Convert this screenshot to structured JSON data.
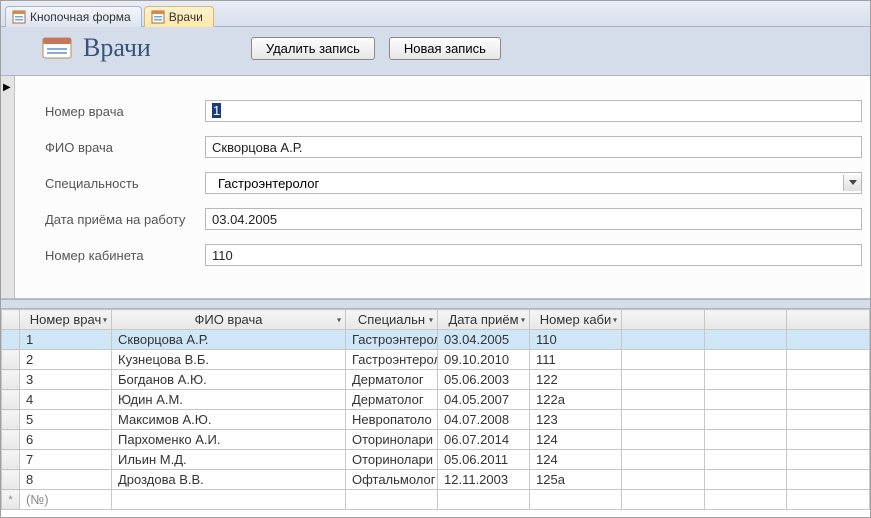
{
  "tabs": [
    {
      "label": "Кнопочная форма",
      "active": false
    },
    {
      "label": "Врачи",
      "active": true
    }
  ],
  "header": {
    "title": "Врачи",
    "delete_label": "Удалить запись",
    "new_label": "Новая запись"
  },
  "fields": {
    "doctor_id": {
      "label": "Номер врача",
      "value": "1"
    },
    "fio": {
      "label": "ФИО врача",
      "value": "Скворцова А.Р."
    },
    "speciality": {
      "label": "Специальность",
      "value": "Гастроэнтеролог"
    },
    "hire_date": {
      "label": "Дата приёма на работу",
      "value": "03.04.2005"
    },
    "cabinet": {
      "label": "Номер кабинета",
      "value": "110"
    }
  },
  "grid": {
    "columns": [
      "Номер врач",
      "ФИО врача",
      "Специальн",
      "Дата приём",
      "Номер каби"
    ],
    "rows": [
      {
        "id": "1",
        "fio": "Скворцова А.Р.",
        "spec": "Гастроэнтерол",
        "date": "03.04.2005",
        "cab": "110",
        "selected": true
      },
      {
        "id": "2",
        "fio": "Кузнецова В.Б.",
        "spec": "Гастроэнтерол",
        "date": "09.10.2010",
        "cab": "111"
      },
      {
        "id": "3",
        "fio": "Богданов А.Ю.",
        "spec": "Дерматолог",
        "date": "05.06.2003",
        "cab": "122"
      },
      {
        "id": "4",
        "fio": "Юдин А.М.",
        "spec": "Дерматолог",
        "date": "04.05.2007",
        "cab": "122а"
      },
      {
        "id": "5",
        "fio": "Максимов А.Ю.",
        "spec": "Невропатоло",
        "date": "04.07.2008",
        "cab": "123"
      },
      {
        "id": "6",
        "fio": "Пархоменко А.И.",
        "spec": "Оторинолари",
        "date": "06.07.2014",
        "cab": "124"
      },
      {
        "id": "7",
        "fio": "Ильин М.Д.",
        "spec": "Оторинолари",
        "date": "05.06.2011",
        "cab": "124"
      },
      {
        "id": "8",
        "fio": "Дроздова В.В.",
        "spec": "Офтальмолог",
        "date": "12.11.2003",
        "cab": "125а"
      }
    ],
    "new_row_marker": "*",
    "new_row_placeholder": "(№)"
  }
}
